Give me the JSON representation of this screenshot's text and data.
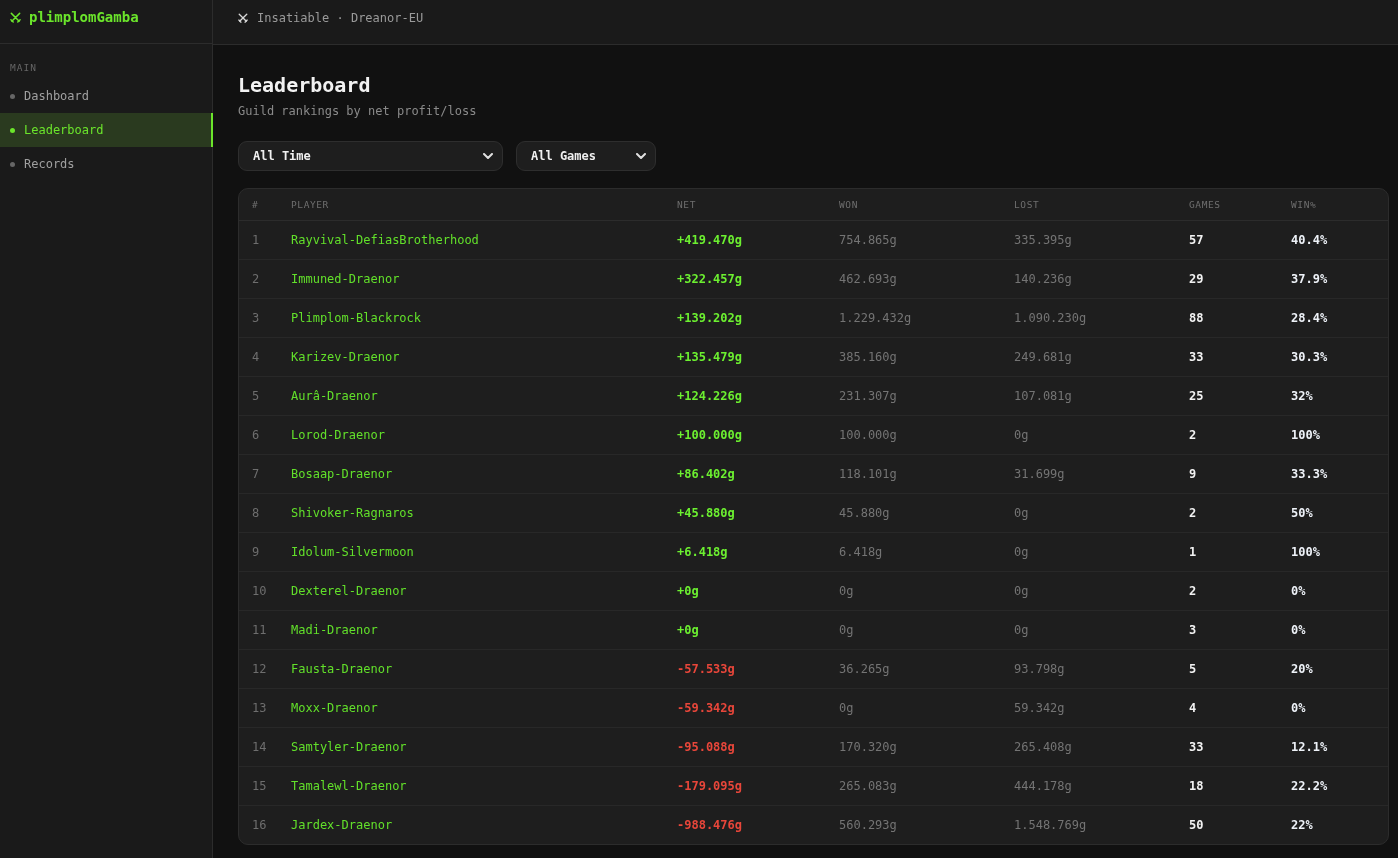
{
  "brand": {
    "name": "plimplomGamba"
  },
  "sidebar": {
    "section": "MAIN",
    "items": [
      {
        "label": "Dashboard",
        "selected": false
      },
      {
        "label": "Leaderboard",
        "selected": true
      },
      {
        "label": "Records",
        "selected": false
      }
    ]
  },
  "topbar": {
    "guild": "Insatiable · Dreanor-EU"
  },
  "page": {
    "title": "Leaderboard",
    "subtitle": "Guild rankings by net profit/loss"
  },
  "filters": [
    {
      "value": "All Time"
    },
    {
      "value": "All Games"
    }
  ],
  "table": {
    "columns": [
      "#",
      "PLAYER",
      "NET",
      "WON",
      "LOST",
      "GAMES",
      "WIN%"
    ],
    "rows": [
      {
        "rank": "1",
        "player": "Rayvival-DefiasBrotherhood",
        "net": "+419.470g",
        "kind": "gain",
        "won": "754.865g",
        "lost": "335.395g",
        "games": "57",
        "win_rate": "40.4%"
      },
      {
        "rank": "2",
        "player": "Immuned-Draenor",
        "net": "+322.457g",
        "kind": "gain",
        "won": "462.693g",
        "lost": "140.236g",
        "games": "29",
        "win_rate": "37.9%"
      },
      {
        "rank": "3",
        "player": "Plimplom-Blackrock",
        "net": "+139.202g",
        "kind": "gain",
        "won": "1.229.432g",
        "lost": "1.090.230g",
        "games": "88",
        "win_rate": "28.4%"
      },
      {
        "rank": "4",
        "player": "Karizev-Draenor",
        "net": "+135.479g",
        "kind": "gain",
        "won": "385.160g",
        "lost": "249.681g",
        "games": "33",
        "win_rate": "30.3%"
      },
      {
        "rank": "5",
        "player": "Aurâ-Draenor",
        "net": "+124.226g",
        "kind": "gain",
        "won": "231.307g",
        "lost": "107.081g",
        "games": "25",
        "win_rate": "32%"
      },
      {
        "rank": "6",
        "player": "Lorod-Draenor",
        "net": "+100.000g",
        "kind": "gain",
        "won": "100.000g",
        "lost": "0g",
        "games": "2",
        "win_rate": "100%"
      },
      {
        "rank": "7",
        "player": "Bosaap-Draenor",
        "net": "+86.402g",
        "kind": "gain",
        "won": "118.101g",
        "lost": "31.699g",
        "games": "9",
        "win_rate": "33.3%"
      },
      {
        "rank": "8",
        "player": "Shivoker-Ragnaros",
        "net": "+45.880g",
        "kind": "gain",
        "won": "45.880g",
        "lost": "0g",
        "games": "2",
        "win_rate": "50%"
      },
      {
        "rank": "9",
        "player": "Idolum-Silvermoon",
        "net": "+6.418g",
        "kind": "gain",
        "won": "6.418g",
        "lost": "0g",
        "games": "1",
        "win_rate": "100%"
      },
      {
        "rank": "10",
        "player": "Dexterel-Draenor",
        "net": "+0g",
        "kind": "gain",
        "won": "0g",
        "lost": "0g",
        "games": "2",
        "win_rate": "0%"
      },
      {
        "rank": "11",
        "player": "Madi-Draenor",
        "net": "+0g",
        "kind": "gain",
        "won": "0g",
        "lost": "0g",
        "games": "3",
        "win_rate": "0%"
      },
      {
        "rank": "12",
        "player": "Fausta-Draenor",
        "net": "-57.533g",
        "kind": "loss",
        "won": "36.265g",
        "lost": "93.798g",
        "games": "5",
        "win_rate": "20%"
      },
      {
        "rank": "13",
        "player": "Moxx-Draenor",
        "net": "-59.342g",
        "kind": "loss",
        "won": "0g",
        "lost": "59.342g",
        "games": "4",
        "win_rate": "0%"
      },
      {
        "rank": "14",
        "player": "Samtyler-Draenor",
        "net": "-95.088g",
        "kind": "loss",
        "won": "170.320g",
        "lost": "265.408g",
        "games": "33",
        "win_rate": "12.1%"
      },
      {
        "rank": "15",
        "player": "Tamalewl-Draenor",
        "net": "-179.095g",
        "kind": "loss",
        "won": "265.083g",
        "lost": "444.178g",
        "games": "18",
        "win_rate": "22.2%"
      },
      {
        "rank": "16",
        "player": "Jardex-Draenor",
        "net": "-988.476g",
        "kind": "loss",
        "won": "560.293g",
        "lost": "1.548.769g",
        "games": "50",
        "win_rate": "22%"
      }
    ]
  }
}
